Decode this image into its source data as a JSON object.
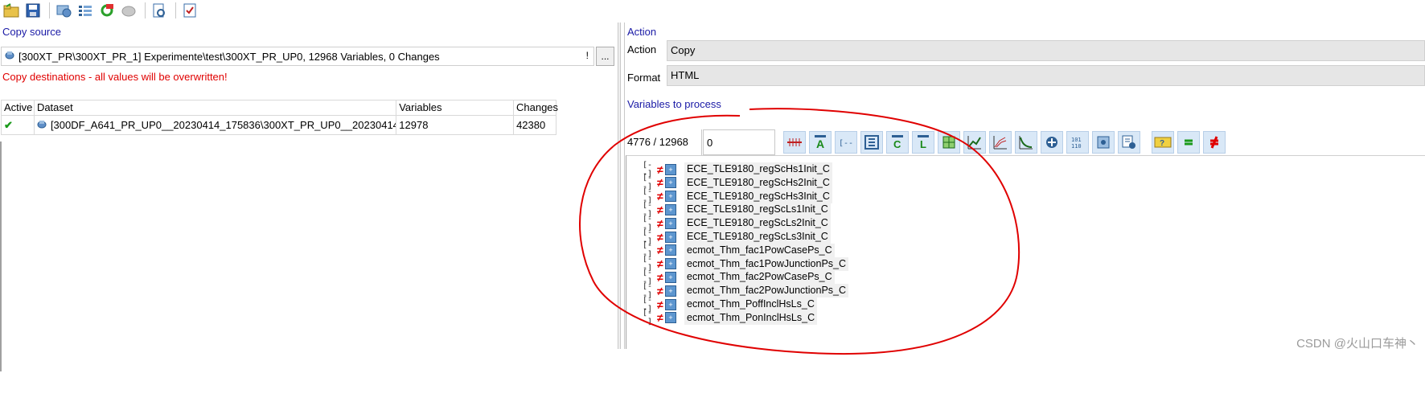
{
  "toolbar": {
    "icons": [
      "open-folder-icon",
      "save-icon",
      "connect-icon",
      "list-icon",
      "refresh-icon",
      "disabled-icon",
      "inspect-icon",
      "checklist-icon"
    ]
  },
  "left": {
    "copy_source_label": "Copy source",
    "source_value": "[300XT_PR\\300XT_PR_1] Experimente\\test\\300XT_PR_UP0, 12968 Variables, 0 Changes",
    "source_marker": "!",
    "browse_label": "...",
    "copy_dest_label": "Copy destinations - all values will be overwritten!",
    "columns": [
      "Active",
      "Dataset",
      "Variables",
      "Changes"
    ],
    "rows": [
      {
        "active": "✔",
        "dataset": "[300DF_A641_PR_UP0__20230414_175836\\300XT_PR_UP0__20230414_1758:",
        "variables": "12978",
        "changes": "42380"
      }
    ]
  },
  "right": {
    "action_header": "Action",
    "action_label": "Action",
    "action_value": "Copy",
    "format_label": "Format",
    "format_value": "HTML",
    "vars_header": "Variables to process",
    "count": "4776 / 12968",
    "filter_value": "0",
    "variables": [
      "ECE_TLE9180_regScHs1Init_C",
      "ECE_TLE9180_regScHs2Init_C",
      "ECE_TLE9180_regScHs3Init_C",
      "ECE_TLE9180_regScLs1Init_C",
      "ECE_TLE9180_regScLs2Init_C",
      "ECE_TLE9180_regScLs3Init_C",
      "ecmot_Thm_fac1PowCasePs_C",
      "ecmot_Thm_fac1PowJunctionPs_C",
      "ecmot_Thm_fac2PowCasePs_C",
      "ecmot_Thm_fac2PowJunctionPs_C",
      "ecmot_Thm_PoffInclHsLs_C",
      "ecmot_Thm_PonInclHsLs_C"
    ],
    "var_prefix": "[--]"
  },
  "watermark": "CSDN @火山口车神丶",
  "colors": {
    "accent_blue": "#1a1aa6",
    "warning_red": "#e00000",
    "annotation_red": "#e00000"
  }
}
